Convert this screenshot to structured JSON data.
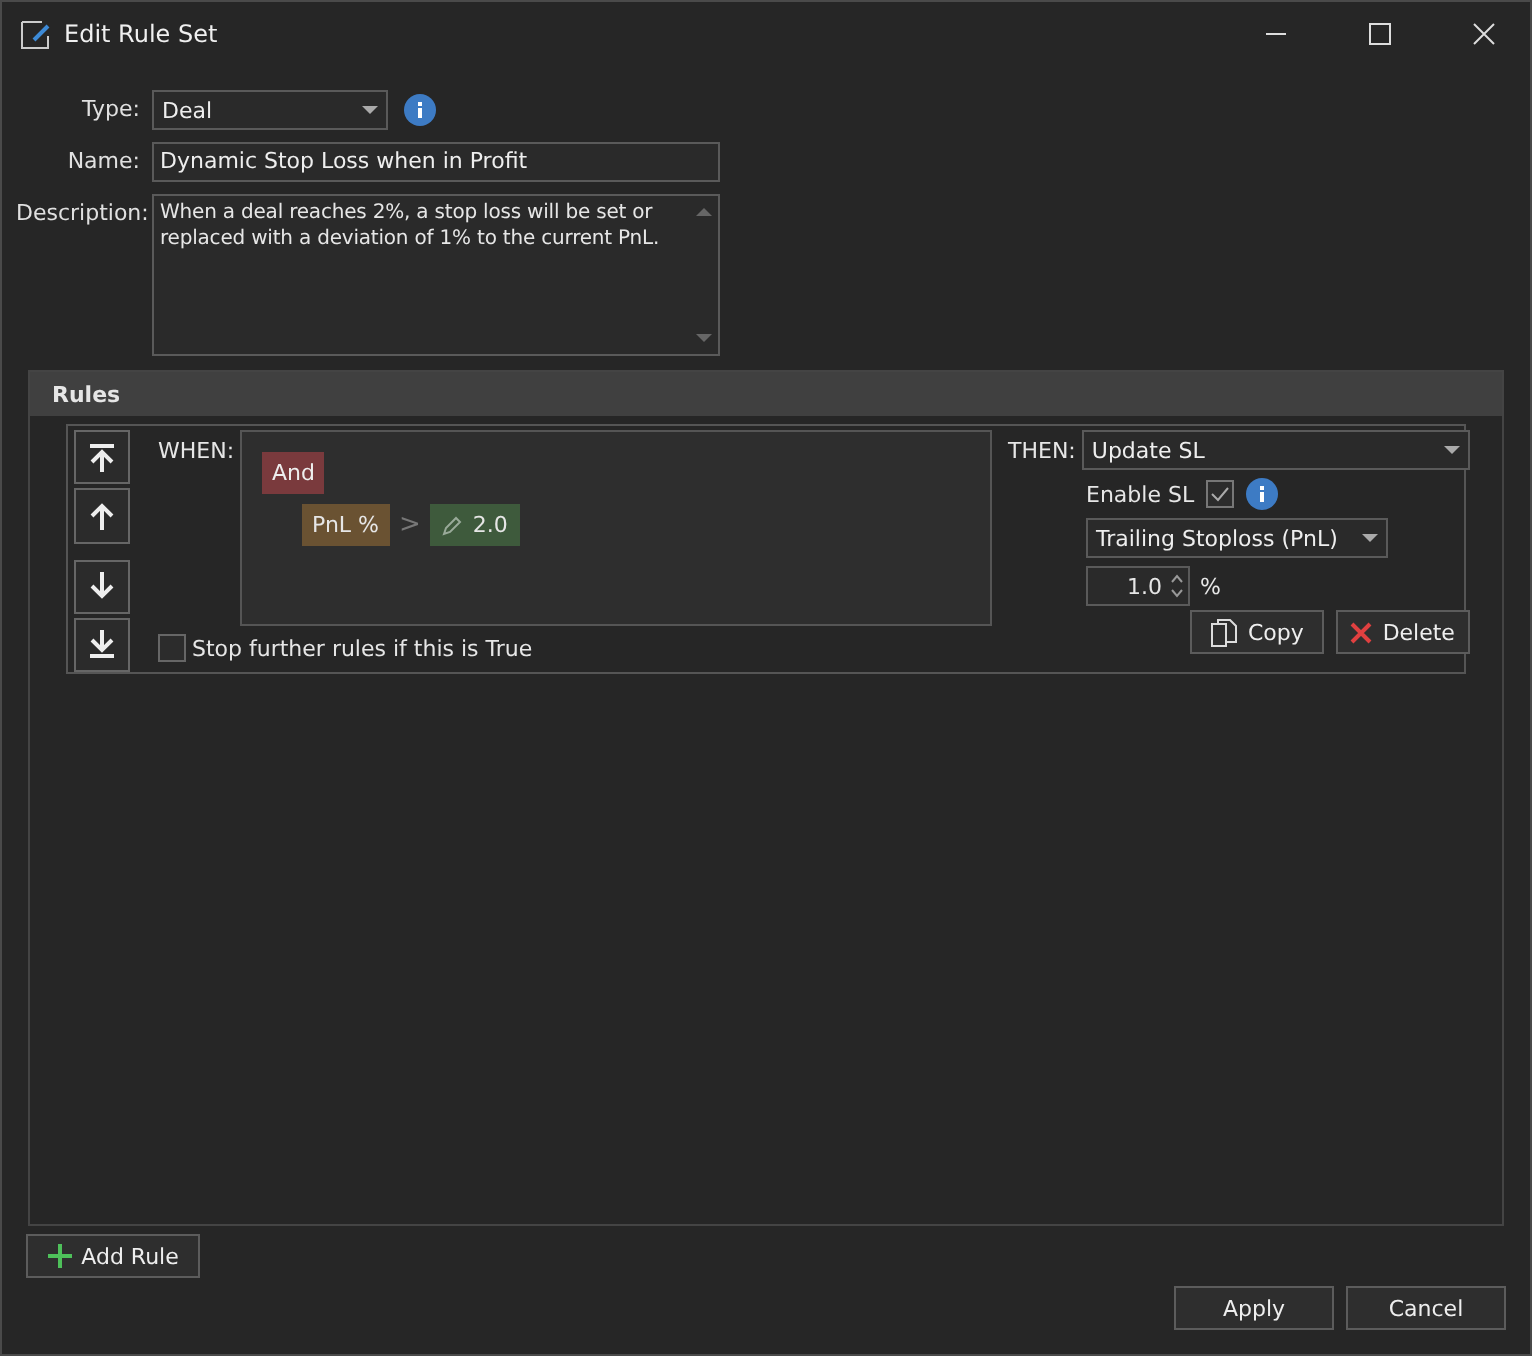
{
  "window": {
    "title": "Edit Rule Set"
  },
  "form": {
    "type": {
      "label": "Type:",
      "value": "Deal"
    },
    "name": {
      "label": "Name:",
      "value": "Dynamic Stop Loss when in Profit"
    },
    "description": {
      "label": "Description:",
      "value": "When a deal reaches 2%, a stop loss will be set or replaced with a deviation of 1% to the current PnL."
    }
  },
  "rules_panel": {
    "title": "Rules",
    "rules": [
      {
        "when_label": "WHEN:",
        "group": {
          "operator": "And",
          "conditions": [
            {
              "field": "PnL %",
              "comparator": ">",
              "value": "2.0"
            }
          ]
        },
        "stop_further": {
          "label": "Stop further rules if this is True",
          "checked": false
        },
        "then_label": "THEN:",
        "action": "Update SL",
        "enable_sl": {
          "label": "Enable SL",
          "checked": true
        },
        "method": "Trailing Stoploss (PnL)",
        "deviation": {
          "value": "1.0",
          "unit": "%"
        },
        "copy_label": "Copy",
        "delete_label": "Delete"
      }
    ]
  },
  "add_rule": "Add Rule",
  "buttons": [
    "Apply",
    "Cancel"
  ]
}
